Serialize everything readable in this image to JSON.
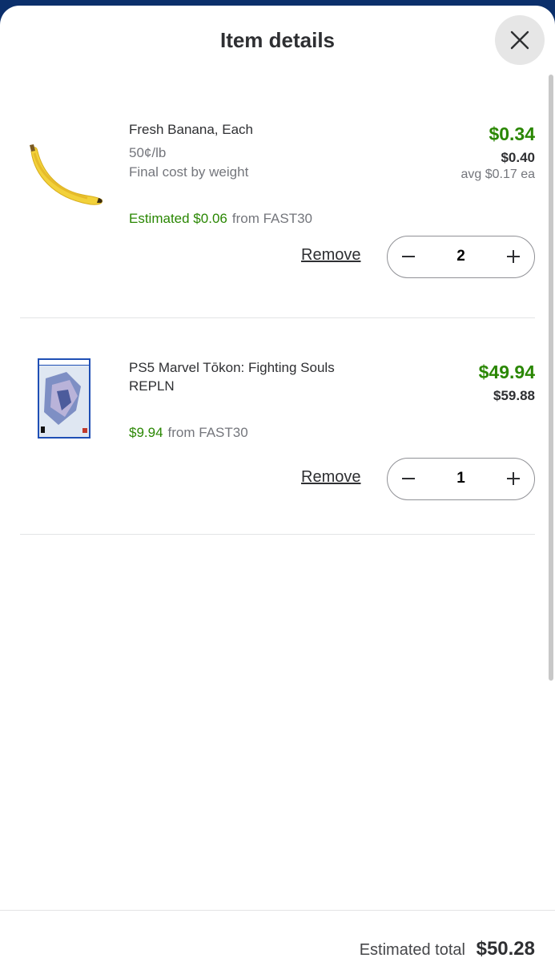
{
  "header": {
    "title": "Item details",
    "close_icon": "close-icon"
  },
  "items": [
    {
      "name": "Fresh Banana, Each",
      "unit_price": "50¢/lb",
      "note": "Final cost by weight",
      "promo_amount": "Estimated $0.06",
      "promo_source": "from FAST30",
      "price": "$0.34",
      "was_price": "$0.40",
      "avg_price": "avg $0.17 ea",
      "remove_label": "Remove",
      "quantity": "2"
    },
    {
      "name": "PS5 Marvel Tōkon: Fighting Souls REPLN",
      "promo_amount": "$9.94",
      "promo_source": "from FAST30",
      "price": "$49.94",
      "was_price": "$59.88",
      "remove_label": "Remove",
      "quantity": "1"
    }
  ],
  "footer": {
    "total_label": "Estimated total",
    "total_value": "$50.28"
  },
  "colors": {
    "accent_green": "#2a8703",
    "header_blue": "#0b2f6b"
  }
}
